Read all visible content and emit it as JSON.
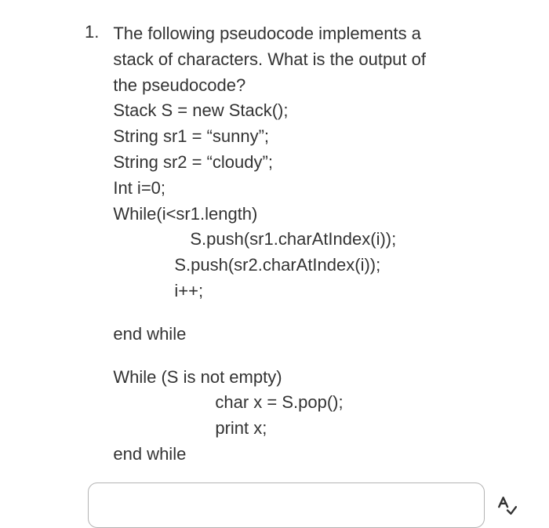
{
  "question": {
    "number": "1.",
    "prompt_lines": [
      "The following pseudocode implements a",
      "stack of characters. What is the output of",
      "the pseudocode?"
    ],
    "code": {
      "l1": "Stack S = new Stack();",
      "l2": "String sr1 = “sunny”;",
      "l3": "String sr2 = “cloudy”;",
      "l4": "Int i=0;",
      "l5": "While(i<sr1.length)",
      "l6": "S.push(sr1.charAtIndex(i));",
      "l7": "S.push(sr2.charAtIndex(i));",
      "l8": "i++;",
      "l9": "end while",
      "l10": "While (S is not empty)",
      "l11": "char x = S.pop();",
      "l12": "print x;",
      "l13": "end while"
    }
  },
  "answer": {
    "value": "",
    "placeholder": ""
  }
}
